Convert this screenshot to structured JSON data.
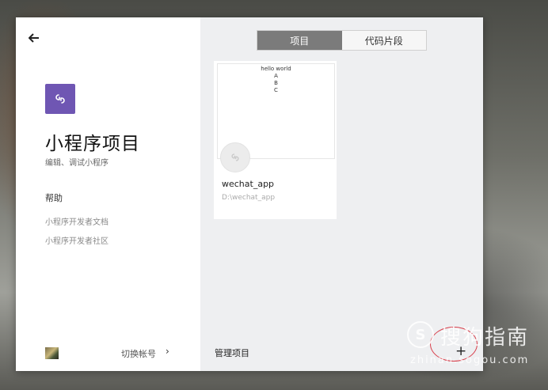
{
  "header": {
    "back_icon": "arrow-left-icon"
  },
  "app": {
    "logo_icon": "link-icon",
    "logo_color": "#6f56b3",
    "title": "小程序项目",
    "subtitle": "编辑、调试小程序"
  },
  "help": {
    "heading": "帮助",
    "links": [
      "小程序开发者文档",
      "小程序开发者社区"
    ]
  },
  "account": {
    "switch_label": "切换帐号",
    "arrow_icon": "chevron-right-icon"
  },
  "tabs": [
    {
      "label": "项目",
      "active": true
    },
    {
      "label": "代码片段",
      "active": false
    }
  ],
  "project": {
    "preview_lines": [
      "hello world",
      "A",
      "B",
      "C"
    ],
    "name": "wechat_app",
    "path": "D:\\wechat_app",
    "icon": "link-icon"
  },
  "footer": {
    "manage_label": "管理项目",
    "add_icon": "plus-icon",
    "add_symbol": "+"
  },
  "watermark": {
    "text": "搜狗指南",
    "url": "zhinan.sogou.com",
    "logo_letter": "S"
  }
}
